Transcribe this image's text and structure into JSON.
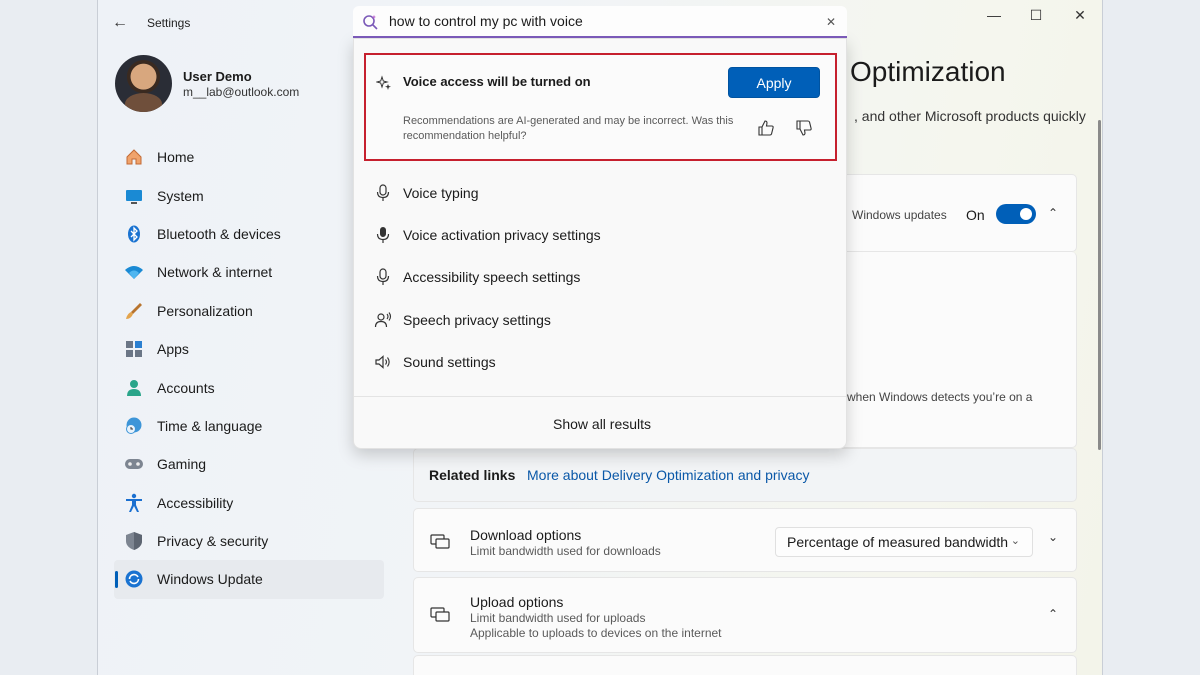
{
  "window": {
    "title": "Settings",
    "back_icon": "back-arrow-icon",
    "controls": {
      "minimize": "minimize-icon",
      "maximize": "maximize-icon",
      "close": "close-icon"
    }
  },
  "user": {
    "name": "User Demo",
    "email": "m__lab@outlook.com"
  },
  "nav": {
    "items": [
      {
        "label": "Home",
        "icon": "home-icon"
      },
      {
        "label": "System",
        "icon": "system-icon"
      },
      {
        "label": "Bluetooth & devices",
        "icon": "bluetooth-icon"
      },
      {
        "label": "Network & internet",
        "icon": "wifi-icon"
      },
      {
        "label": "Personalization",
        "icon": "brush-icon"
      },
      {
        "label": "Apps",
        "icon": "apps-icon"
      },
      {
        "label": "Accounts",
        "icon": "accounts-icon"
      },
      {
        "label": "Time & language",
        "icon": "globe-clock-icon"
      },
      {
        "label": "Gaming",
        "icon": "gamepad-icon"
      },
      {
        "label": "Accessibility",
        "icon": "accessibility-icon"
      },
      {
        "label": "Privacy & security",
        "icon": "shield-icon"
      },
      {
        "label": "Windows Update",
        "icon": "update-icon",
        "active": true
      }
    ]
  },
  "main": {
    "title_partial": "Optimization",
    "desc_partial": ", and other Microsoft products quickly",
    "updates_row": {
      "label_partial": "Windows updates",
      "toggle_state": "On"
    },
    "detect_text_partial": "when Windows detects you’re on a",
    "related_links": {
      "heading": "Related links",
      "link": "More about Delivery Optimization and privacy"
    },
    "download_options": {
      "title": "Download options",
      "subtitle": "Limit bandwidth used for downloads",
      "dropdown_value": "Percentage of measured bandwidth"
    },
    "upload_options": {
      "title": "Upload options",
      "subtitle1": "Limit bandwidth used for uploads",
      "subtitle2": "Applicable to uploads to devices on the internet"
    }
  },
  "search": {
    "query": "how to control my pc with voice",
    "recommendation": {
      "title": "Voice access will be turned on",
      "apply_label": "Apply",
      "note": "Recommendations are AI-generated and may be incorrect. Was this recommendation helpful?"
    },
    "results": [
      {
        "label": "Voice typing",
        "icon": "microphone-icon"
      },
      {
        "label": "Voice activation privacy settings",
        "icon": "microphone-filled-icon"
      },
      {
        "label": "Accessibility speech settings",
        "icon": "microphone-icon"
      },
      {
        "label": "Speech privacy settings",
        "icon": "person-speech-icon"
      },
      {
        "label": "Sound settings",
        "icon": "speaker-icon"
      }
    ],
    "show_all_label": "Show all results"
  },
  "colors": {
    "accent": "#005fb8",
    "highlight_border": "#c6202e",
    "search_underline": "#7b5ab8"
  }
}
